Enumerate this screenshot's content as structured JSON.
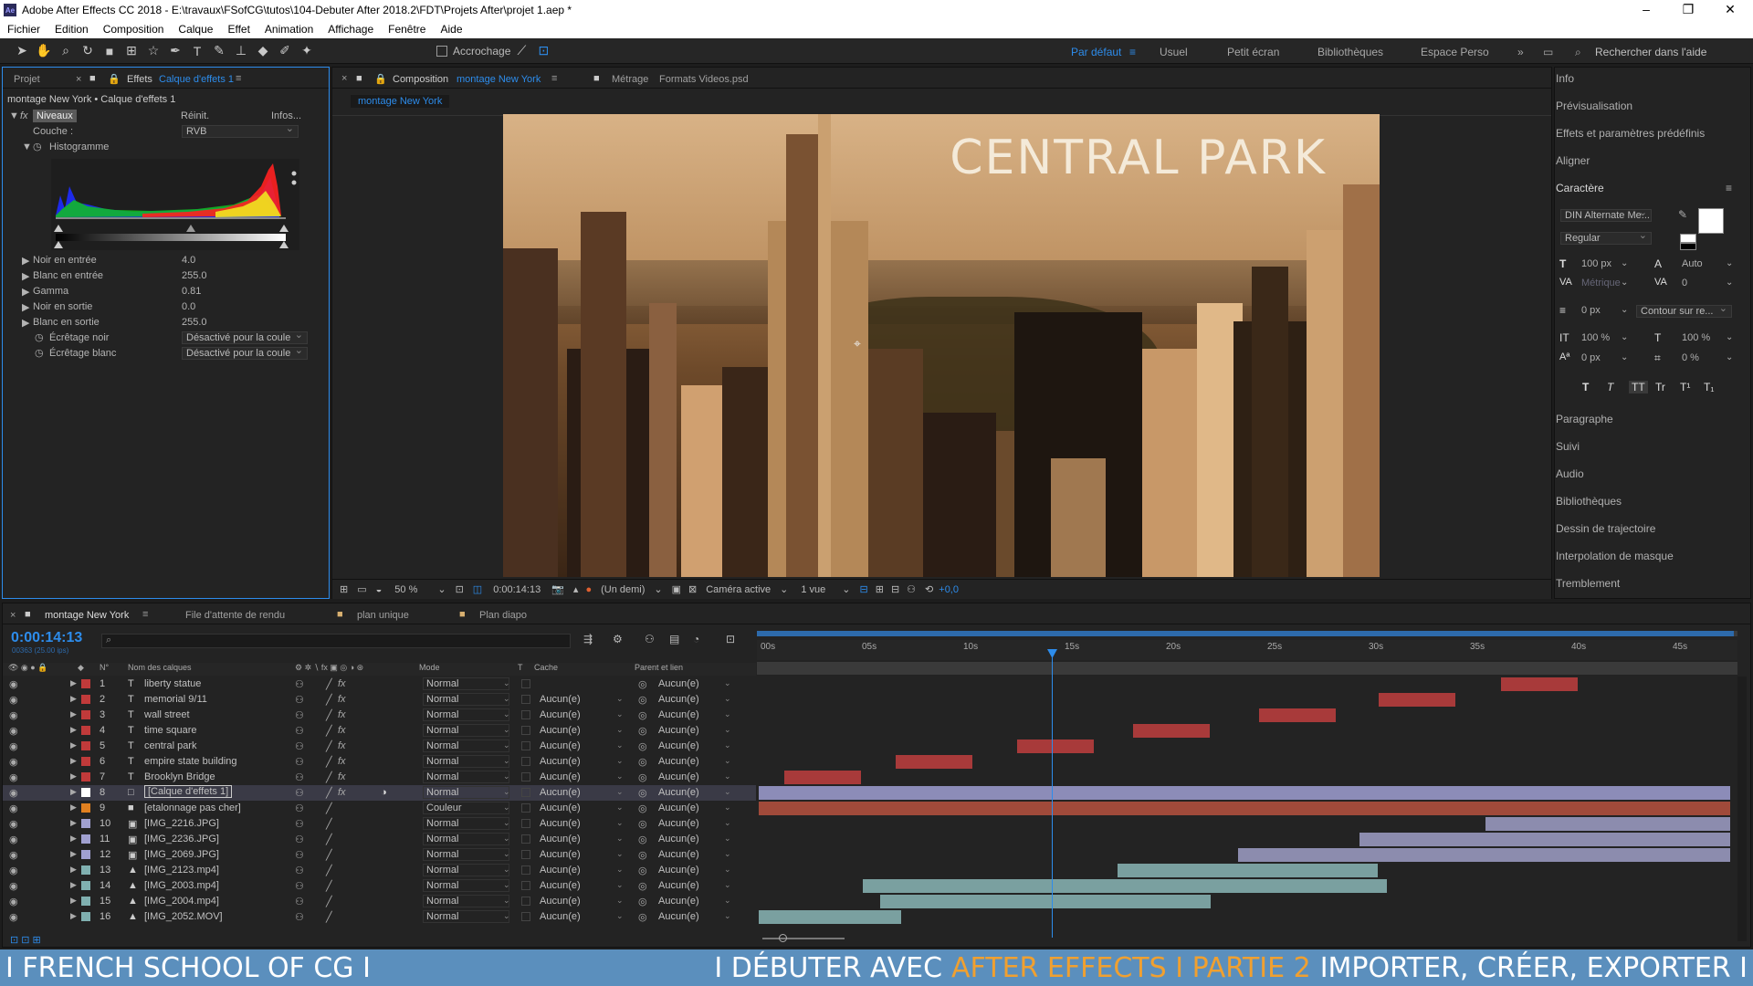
{
  "titlebar": {
    "title": "Adobe After Effects CC 2018 - E:\\travaux\\FSofCG\\tutos\\104-Debuter After 2018.2\\FDT\\Projets After\\projet 1.aep *"
  },
  "menu": [
    "Fichier",
    "Edition",
    "Composition",
    "Calque",
    "Effet",
    "Animation",
    "Affichage",
    "Fenêtre",
    "Aide"
  ],
  "toolbar": {
    "snap_label": "Accrochage",
    "workspaces": [
      "Par défaut",
      "Usuel",
      "Petit écran",
      "Bibliothèques",
      "Espace Perso"
    ],
    "search_placeholder": "Rechercher dans l'aide"
  },
  "left_panel": {
    "tab_project": "Projet",
    "tab_effects": "Effets",
    "tab_effects_layer": "Calque d'effets 1",
    "breadcrumb": "montage New York • Calque d'effets 1",
    "effect_name": "Niveaux",
    "reset": "Réinit.",
    "info": "Infos...",
    "channel_label": "Couche :",
    "channel_value": "RVB",
    "histogram_label": "Histogramme",
    "props": [
      {
        "label": "Noir en entrée",
        "value": "4.0"
      },
      {
        "label": "Blanc en entrée",
        "value": "255.0"
      },
      {
        "label": "Gamma",
        "value": "0.81"
      },
      {
        "label": "Noir en sortie",
        "value": "0.0"
      },
      {
        "label": "Blanc en sortie",
        "value": "255.0"
      }
    ],
    "clip_black_label": "Écrêtage noir",
    "clip_black_value": "Désactivé pour la coule",
    "clip_white_label": "Écrêtage blanc",
    "clip_white_value": "Désactivé pour la coule"
  },
  "comp_panel": {
    "tab_label": "Composition",
    "tab_name": "montage New York",
    "footage_label": "Métrage",
    "footage_name": "Formats Videos.psd",
    "subtab": "montage New York",
    "overlay_title": "CENTRAL PARK",
    "zoom": "50 %",
    "timecode": "0:00:14:13",
    "resolution": "(Un demi)",
    "camera": "Caméra active",
    "views": "1 vue",
    "exposure": "+0,0"
  },
  "right_panel": {
    "items_top": [
      "Info",
      "Prévisualisation",
      "Effets et paramètres prédéfinis",
      "Aligner"
    ],
    "character": "Caractère",
    "font": "DIN Alternate Me...",
    "style": "Regular",
    "size": "100 px",
    "leading": "Auto",
    "kerning": "Métrique",
    "tracking": "0",
    "stroke": "0 px",
    "stroke_type": "Contour sur re...",
    "vscale": "100 %",
    "hscale": "100 %",
    "baseline": "0 px",
    "tsume": "0 %",
    "text_styles": [
      "T",
      "T",
      "TT",
      "Tr",
      "T¹",
      "T₁"
    ],
    "items_bottom": [
      "Paragraphe",
      "Suivi",
      "Audio",
      "Bibliothèques",
      "Dessin de trajectoire",
      "Interpolation de masque",
      "Tremblement"
    ]
  },
  "timeline": {
    "tab": "montage New York",
    "render_queue": "File d'attente de rendu",
    "tab2": "plan unique",
    "tab3": "Plan diapo",
    "timecode": "0:00:14:13",
    "frame_info": "00363 (25.00 ips)",
    "col_num": "N°",
    "col_name": "Nom des calques",
    "col_mode": "Mode",
    "col_t": "T",
    "col_cache": "Cache",
    "col_parent": "Parent et lien",
    "ruler": [
      "00s",
      "05s",
      "10s",
      "15s",
      "20s",
      "25s",
      "30s",
      "35s",
      "40s",
      "45s"
    ],
    "layers": [
      {
        "num": "1",
        "type": "T",
        "name": "liberty statue",
        "mode": "Normal",
        "cache": "",
        "parent": "Aucun(e)",
        "color": "#c03a3a"
      },
      {
        "num": "2",
        "type": "T",
        "name": "memorial 9/11",
        "mode": "Normal",
        "cache": "Aucun(e)",
        "parent": "Aucun(e)",
        "color": "#c03a3a"
      },
      {
        "num": "3",
        "type": "T",
        "name": "wall street",
        "mode": "Normal",
        "cache": "Aucun(e)",
        "parent": "Aucun(e)",
        "color": "#c03a3a"
      },
      {
        "num": "4",
        "type": "T",
        "name": "time square",
        "mode": "Normal",
        "cache": "Aucun(e)",
        "parent": "Aucun(e)",
        "color": "#c03a3a"
      },
      {
        "num": "5",
        "type": "T",
        "name": "central park",
        "mode": "Normal",
        "cache": "Aucun(e)",
        "parent": "Aucun(e)",
        "color": "#c03a3a"
      },
      {
        "num": "6",
        "type": "T",
        "name": "empire state building",
        "mode": "Normal",
        "cache": "Aucun(e)",
        "parent": "Aucun(e)",
        "color": "#c03a3a"
      },
      {
        "num": "7",
        "type": "T",
        "name": "Brooklyn Bridge",
        "mode": "Normal",
        "cache": "Aucun(e)",
        "parent": "Aucun(e)",
        "color": "#c03a3a"
      },
      {
        "num": "8",
        "type": "□",
        "name": "[Calque d'effets 1]",
        "mode": "Normal",
        "cache": "Aucun(e)",
        "parent": "Aucun(e)",
        "color": "#ffffff"
      },
      {
        "num": "9",
        "type": "■",
        "name": "[etalonnage pas cher]",
        "mode": "Couleur",
        "cache": "Aucun(e)",
        "parent": "Aucun(e)",
        "color": "#e08020"
      },
      {
        "num": "10",
        "type": "▣",
        "name": "[IMG_2216.JPG]",
        "mode": "Normal",
        "cache": "Aucun(e)",
        "parent": "Aucun(e)",
        "color": "#a0a0d0"
      },
      {
        "num": "11",
        "type": "▣",
        "name": "[IMG_2236.JPG]",
        "mode": "Normal",
        "cache": "Aucun(e)",
        "parent": "Aucun(e)",
        "color": "#a0a0d0"
      },
      {
        "num": "12",
        "type": "▣",
        "name": "[IMG_2069.JPG]",
        "mode": "Normal",
        "cache": "Aucun(e)",
        "parent": "Aucun(e)",
        "color": "#a0a0d0"
      },
      {
        "num": "13",
        "type": "▲",
        "name": "[IMG_2123.mp4]",
        "mode": "Normal",
        "cache": "Aucun(e)",
        "parent": "Aucun(e)",
        "color": "#80b0b0"
      },
      {
        "num": "14",
        "type": "▲",
        "name": "[IMG_2003.mp4]",
        "mode": "Normal",
        "cache": "Aucun(e)",
        "parent": "Aucun(e)",
        "color": "#80b0b0"
      },
      {
        "num": "15",
        "type": "▲",
        "name": "[IMG_2004.mp4]",
        "mode": "Normal",
        "cache": "Aucun(e)",
        "parent": "Aucun(e)",
        "color": "#80b0b0"
      },
      {
        "num": "16",
        "type": "▲",
        "name": "[IMG_2052.MOV]",
        "mode": "Normal",
        "cache": "Aucun(e)",
        "parent": "Aucun(e)",
        "color": "#80b0b0"
      }
    ]
  },
  "banner": {
    "left": "I FRENCH SCHOOL OF CG I",
    "right_a": "I DÉBUTER AVEC",
    "right_b": "AFTER EFFECTS I PARTIE 2",
    "right_c": "IMPORTER, CRÉER, EXPORTER I"
  }
}
